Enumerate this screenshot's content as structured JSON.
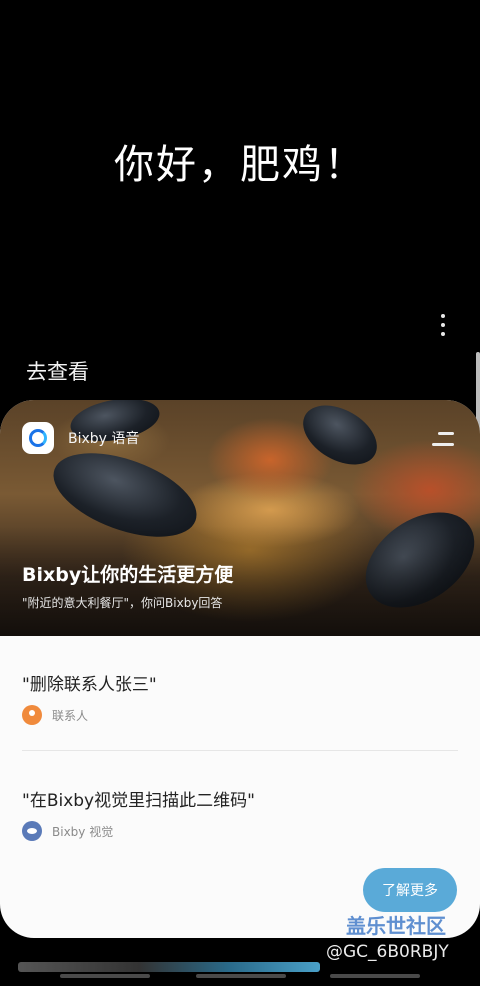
{
  "greeting": "你好，肥鸡！",
  "section_title": "去查看",
  "card": {
    "app_name": "Bixby 语音",
    "hero_title": "Bixby让你的生活更方便",
    "hero_subtitle": "\"附近的意大利餐厅\"，你问Bixby回答",
    "items": [
      {
        "text": "\"删除联系人张三\"",
        "meta": "联系人",
        "icon": "contact-icon"
      },
      {
        "text": "\"在Bixby视觉里扫描此二维码\"",
        "meta": "Bixby 视觉",
        "icon": "bixby-vision-icon"
      }
    ],
    "learn_more_label": "了解更多"
  },
  "watermark": {
    "site": "盖乐世社区",
    "user": "@GC_6B0RBJY"
  },
  "colors": {
    "background": "#000000",
    "card": "#fbfbfb",
    "accent": "#5aaad8",
    "contact_icon": "#f08a3c",
    "vision_icon": "#5a7ab8"
  }
}
